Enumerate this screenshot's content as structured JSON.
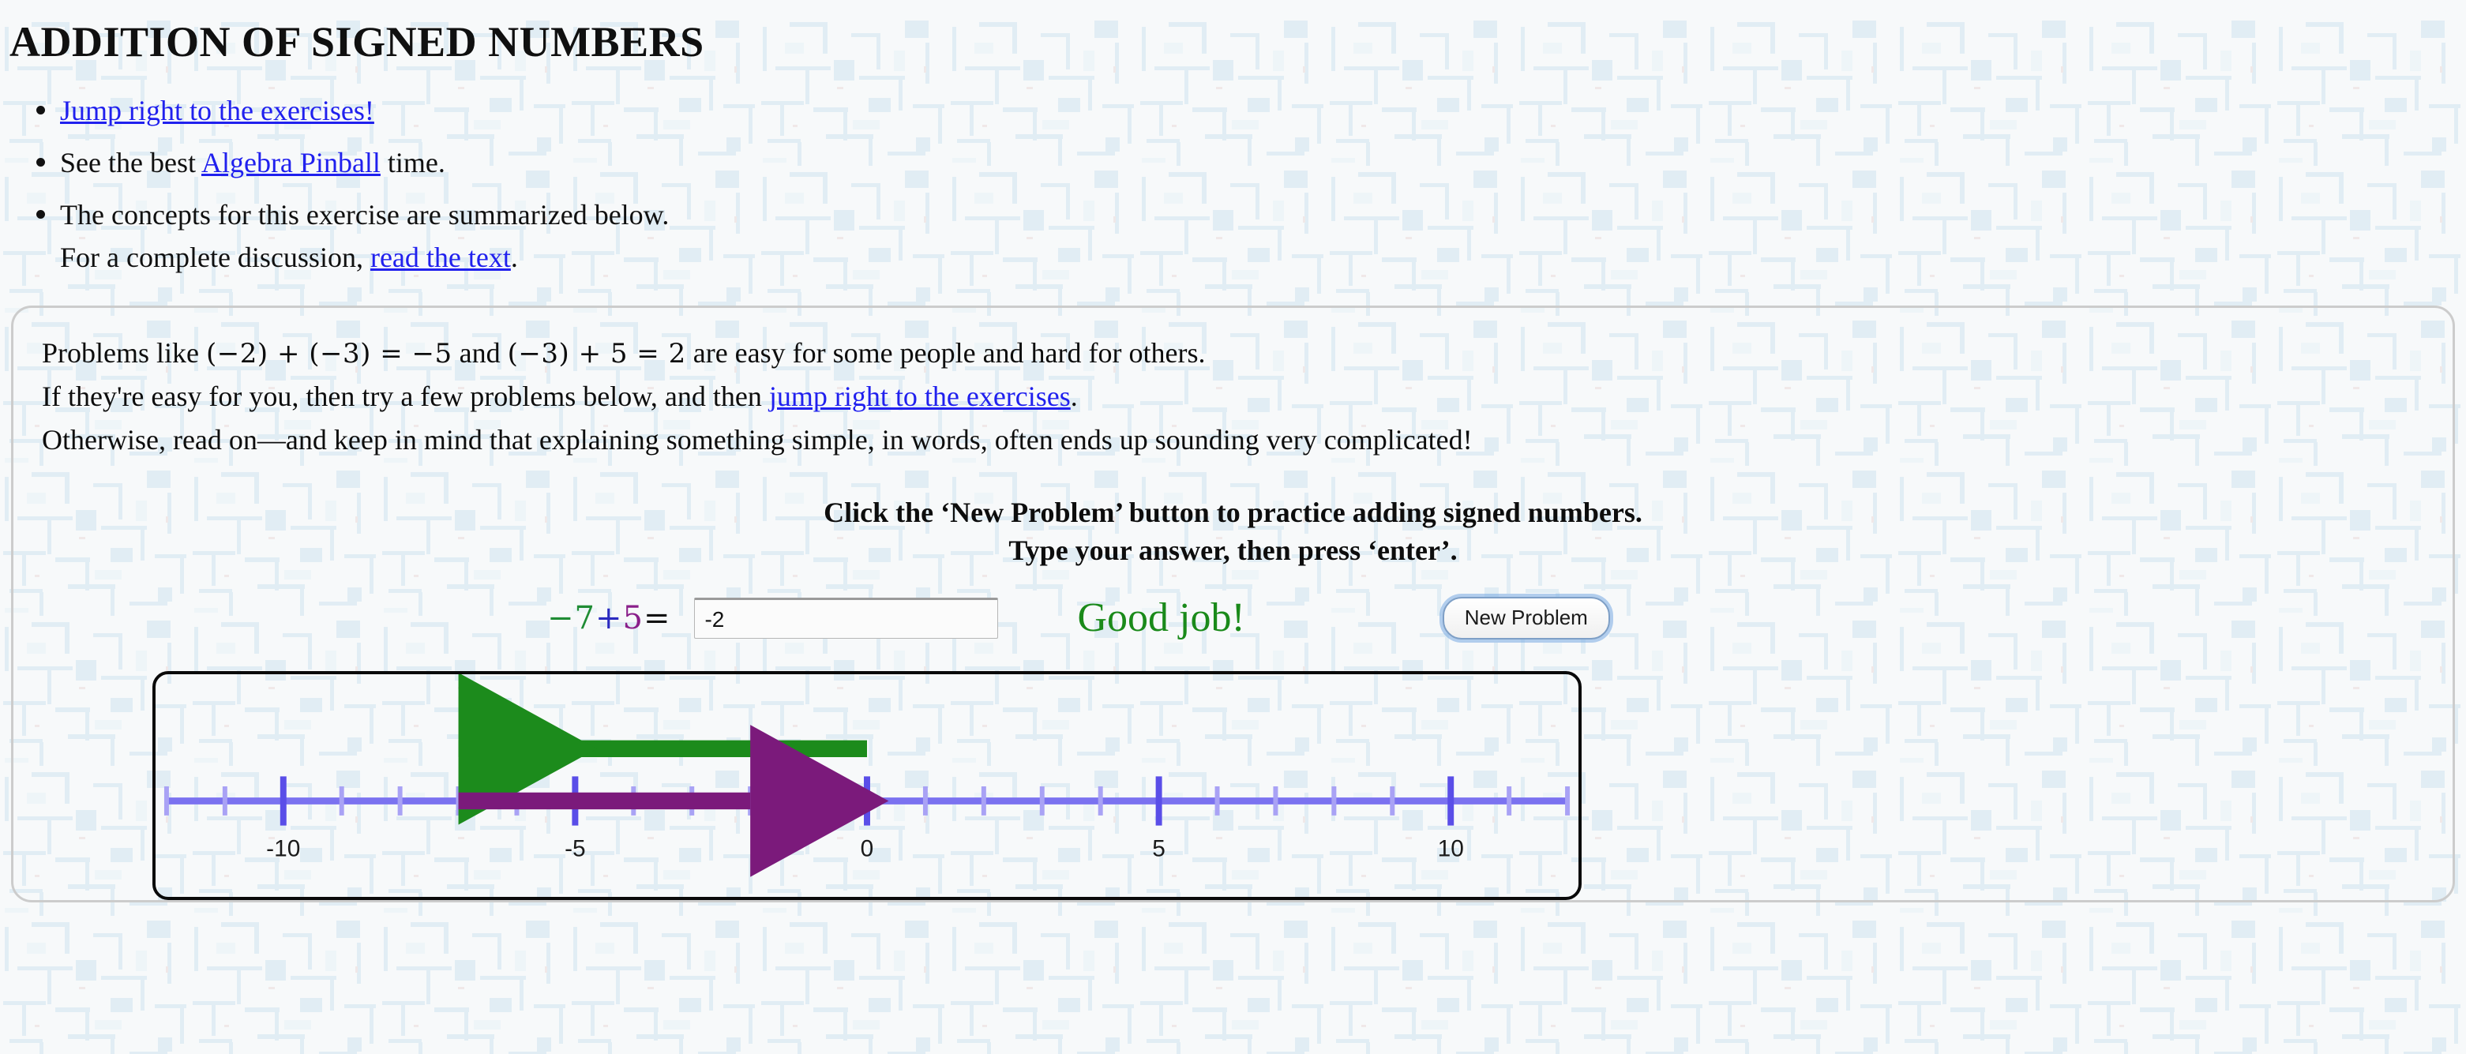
{
  "page": {
    "title": "ADDITION OF SIGNED NUMBERS",
    "background_color": "#f7f9fa",
    "texture_color": "#e3eef4"
  },
  "intro_list": [
    {
      "id": "jump-to-exercises",
      "prefix": "",
      "link": "Jump right to the exercises!",
      "suffix": ""
    },
    {
      "id": "algebra-pinball",
      "prefix": "See the best ",
      "link": "Algebra Pinball",
      "suffix": " time."
    },
    {
      "id": "concepts-summary",
      "line1": "The concepts for this exercise are summarized below.",
      "line2_prefix": "For a complete discussion, ",
      "link": "read the text",
      "line2_suffix": "."
    }
  ],
  "panel": {
    "paragraph": {
      "line1_part1": "Problems like",
      "line1_math1": "(−2) + (−3) = −5",
      "line1_part2": "and",
      "line1_math2": "(−3) + 5 = 2",
      "line1_part3": "are easy for some people and hard for others.",
      "line2_prefix": "If they're easy for you, then try a few problems below, and then ",
      "line2_link": "jump right to the exercises",
      "line2_suffix": ".",
      "line3": "Otherwise, read on—and keep in mind that explaining something simple, in words, often ends up sounding very complicated!"
    },
    "instructions": {
      "line1": "Click the ‘New Problem’ button to practice adding signed numbers.",
      "line2": "Type your answer, then press ‘enter’."
    },
    "exercise": {
      "addend_a": "−7",
      "operator": "+",
      "addend_b": "5",
      "equals": "=",
      "addend_a_color": "#1f8c34",
      "addend_b_color": "#8a1f8a",
      "answer_value": "-2",
      "answer_placeholder": "",
      "feedback": "Good job!",
      "feedback_color": "#1a8a1a",
      "new_problem_label": "New Problem"
    }
  },
  "chart_data": {
    "type": "number-line",
    "title": "",
    "xlabel": "",
    "ylabel": "",
    "xlim": [
      -12,
      12
    ],
    "grid": false,
    "minor_tick_step": 1,
    "major_ticks": [
      -10,
      -5,
      0,
      5,
      10
    ],
    "tick_labels": [
      "-10",
      "-5",
      "0",
      "5",
      "10"
    ],
    "axis_color": "#7b72f0",
    "minor_tick_color": "#a9a2f5",
    "major_tick_color": "#5a4ee8",
    "arrows": [
      {
        "name": "first-addend-arrow",
        "label": "−7",
        "from": 0,
        "to": -7,
        "direction": "left",
        "color": "#1c8b1c",
        "row": "upper"
      },
      {
        "name": "second-addend-arrow",
        "label": "+5",
        "from": -7,
        "to": -2,
        "direction": "right",
        "color": "#7b1a7b",
        "row": "axis"
      }
    ]
  }
}
